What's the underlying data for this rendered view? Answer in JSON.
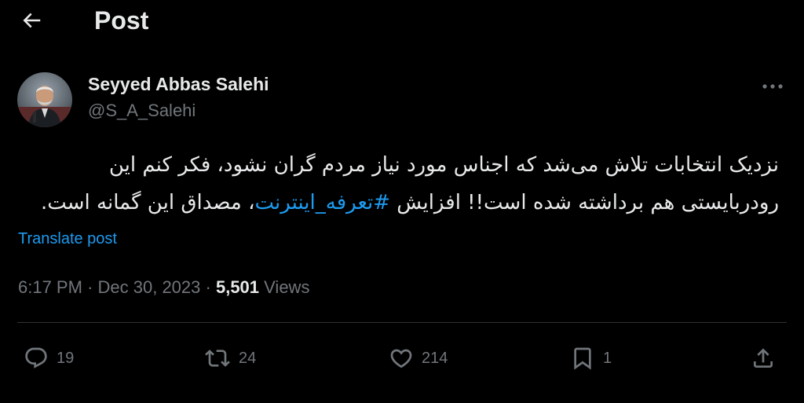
{
  "header": {
    "title": "Post",
    "back_icon": "arrow-left-icon"
  },
  "author": {
    "name": "Seyyed Abbas Salehi",
    "handle": "@S_A_Salehi"
  },
  "tweet": {
    "line1": "نزدیک انتخابات تلاش می‌شد که اجناس مورد نیاز مردم گران نشود، فکر کنم این",
    "line2_before": "رودربایستی هم برداشته شده است!! افزایش ",
    "hashtag": "#تعرفه_اینترنت",
    "line2_after": "، مصداق این گمانه است."
  },
  "translate_label": "Translate post",
  "meta": {
    "time": "6:17 PM",
    "separator": "·",
    "date": "Dec 30, 2023",
    "views_count": "5,501",
    "views_label": "Views"
  },
  "actions": {
    "replies": "19",
    "reposts": "24",
    "likes": "214",
    "bookmarks": "1"
  },
  "colors": {
    "background": "#000000",
    "text": "#e7e9ea",
    "secondary": "#71767b",
    "accent": "#1d9bf0",
    "divider": "#2f3336"
  }
}
